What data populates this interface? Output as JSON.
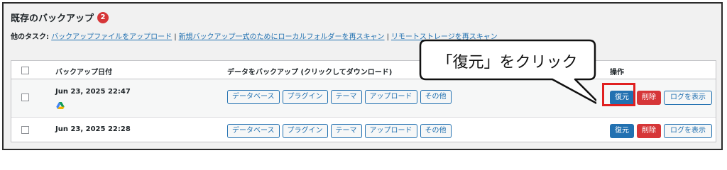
{
  "section": {
    "title": "既存のバックアップ",
    "count": "2"
  },
  "other_tasks": {
    "label": "他のタスク:",
    "links": [
      "バックアップファイルをアップロード",
      "新規バックアップ一式のためにローカルフォルダーを再スキャン",
      "リモートストレージを再スキャン"
    ]
  },
  "table": {
    "headers": {
      "date": "バックアップ日付",
      "download": "データをバックアップ (クリックしてダウンロード)",
      "actions": "操作"
    },
    "download_labels": [
      "データベース",
      "プラグイン",
      "テーマ",
      "アップロード",
      "その他"
    ],
    "rows": [
      {
        "date": "Jun 23, 2025 22:47",
        "storage_icon": "google-drive-icon"
      },
      {
        "date": "Jun 23, 2025 22:28"
      }
    ],
    "actions": {
      "restore": "復元",
      "delete": "削除",
      "log": "ログを表示"
    }
  },
  "callout": {
    "text": "「復元」をクリック"
  },
  "colors": {
    "link": "#2271b1",
    "primary": "#2271b1",
    "danger": "#d63638",
    "highlight": "#e02020"
  }
}
